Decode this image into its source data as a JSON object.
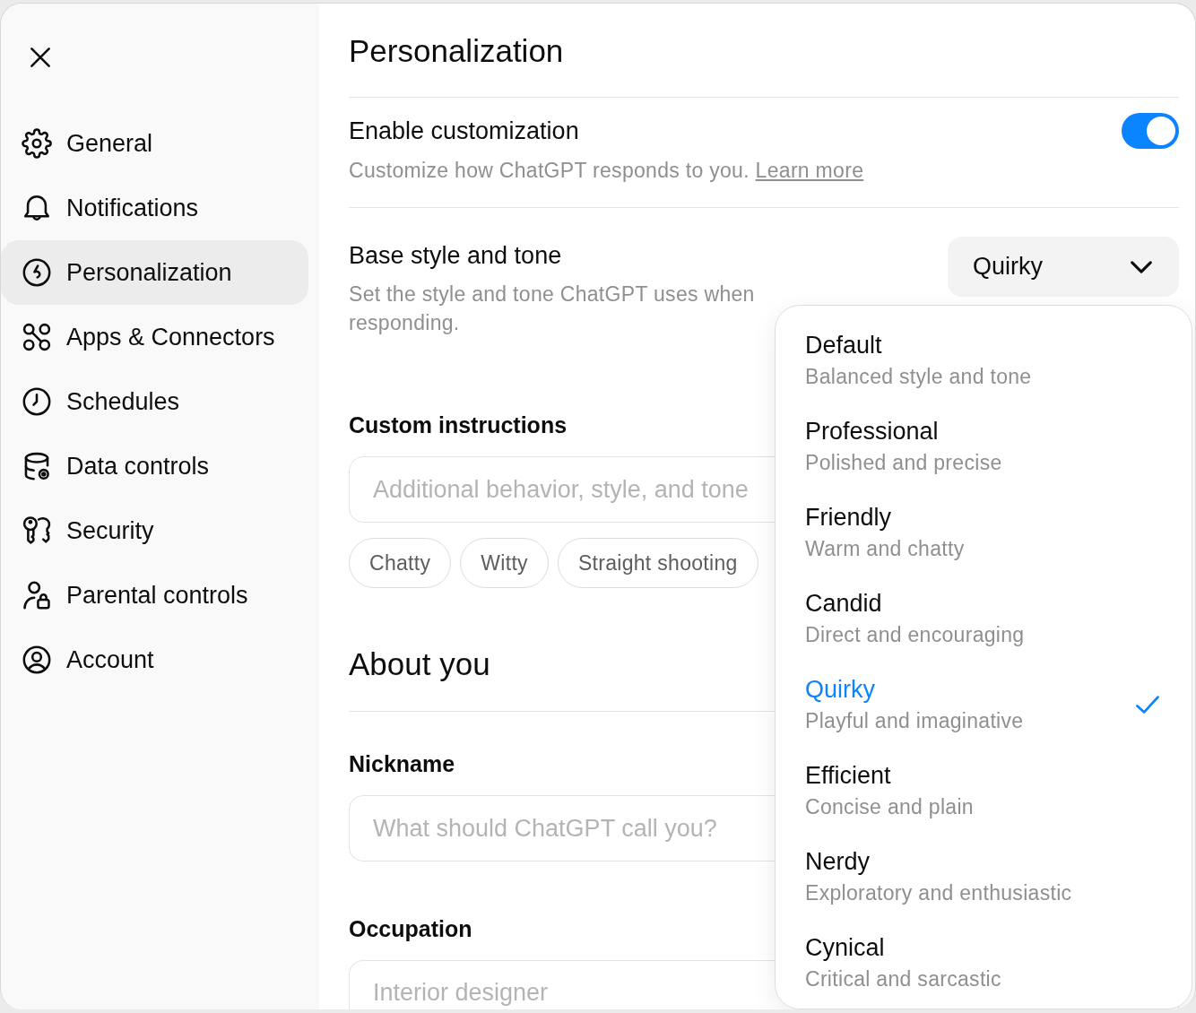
{
  "sidebar": {
    "items": [
      {
        "label": "General",
        "selected": false
      },
      {
        "label": "Notifications",
        "selected": false
      },
      {
        "label": "Personalization",
        "selected": true
      },
      {
        "label": "Apps & Connectors",
        "selected": false
      },
      {
        "label": "Schedules",
        "selected": false
      },
      {
        "label": "Data controls",
        "selected": false
      },
      {
        "label": "Security",
        "selected": false
      },
      {
        "label": "Parental controls",
        "selected": false
      },
      {
        "label": "Account",
        "selected": false
      }
    ]
  },
  "page": {
    "title": "Personalization"
  },
  "settings": [
    {
      "kind": "toggle",
      "label": "Enable customization",
      "description": "Customize how ChatGPT responds to you.",
      "link": "Learn more",
      "on": true
    },
    {
      "kind": "select",
      "label": "Base style and tone",
      "description": "Set the style and tone ChatGPT uses when responding.",
      "value": "Quirky",
      "expanded": true,
      "options": [
        {
          "title": "Default",
          "subtitle": "Balanced style and tone",
          "selected": false
        },
        {
          "title": "Professional",
          "subtitle": "Polished and precise",
          "selected": false
        },
        {
          "title": "Friendly",
          "subtitle": "Warm and chatty",
          "selected": false
        },
        {
          "title": "Candid",
          "subtitle": "Direct and encouraging",
          "selected": false
        },
        {
          "title": "Quirky",
          "subtitle": "Playful and imaginative",
          "selected": true
        },
        {
          "title": "Efficient",
          "subtitle": "Concise and plain",
          "selected": false
        },
        {
          "title": "Nerdy",
          "subtitle": "Exploratory and enthusiastic",
          "selected": false
        },
        {
          "title": "Cynical",
          "subtitle": "Critical and sarcastic",
          "selected": false
        }
      ]
    }
  ],
  "custom_instructions": {
    "label": "Custom instructions",
    "placeholder": "Additional behavior, style, and tone",
    "chips": [
      "Chatty",
      "Witty",
      "Straight shooting"
    ]
  },
  "about_you": {
    "title": "About you",
    "fields": [
      {
        "label": "Nickname",
        "placeholder": "What should ChatGPT call you?"
      },
      {
        "label": "Occupation",
        "placeholder": "Interior designer"
      }
    ]
  }
}
